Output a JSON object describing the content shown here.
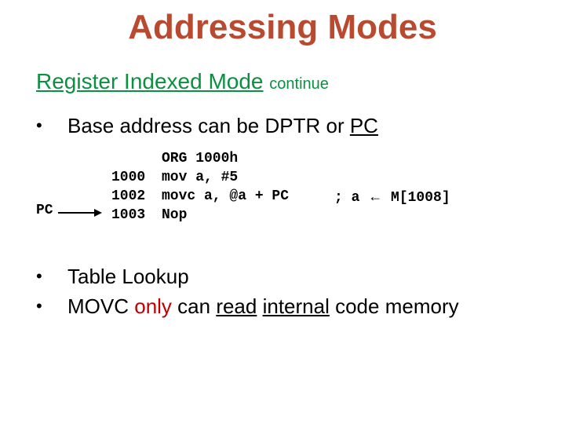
{
  "title": "Addressing Modes",
  "subtitle_main": "Register Indexed Mode",
  "subtitle_cont": "continue",
  "bullet1_pre": "Base address can be DPTR or ",
  "bullet1_u": "PC",
  "pc_label": "PC",
  "addr": "1000\n1002\n1003",
  "instr": "ORG 1000h\nmov a, #5\nmovc a, @a + PC\nNop",
  "comment_pre": "; a ",
  "comment_arrow": "←",
  "comment_post": " M[1008]",
  "bullet2": "Table Lookup",
  "bullet3_p1": "MOVC ",
  "bullet3_p2": "only",
  "bullet3_p3": " can ",
  "bullet3_p4": "read",
  "bullet3_p5": " ",
  "bullet3_p6": "internal",
  "bullet3_p7": " code memory"
}
